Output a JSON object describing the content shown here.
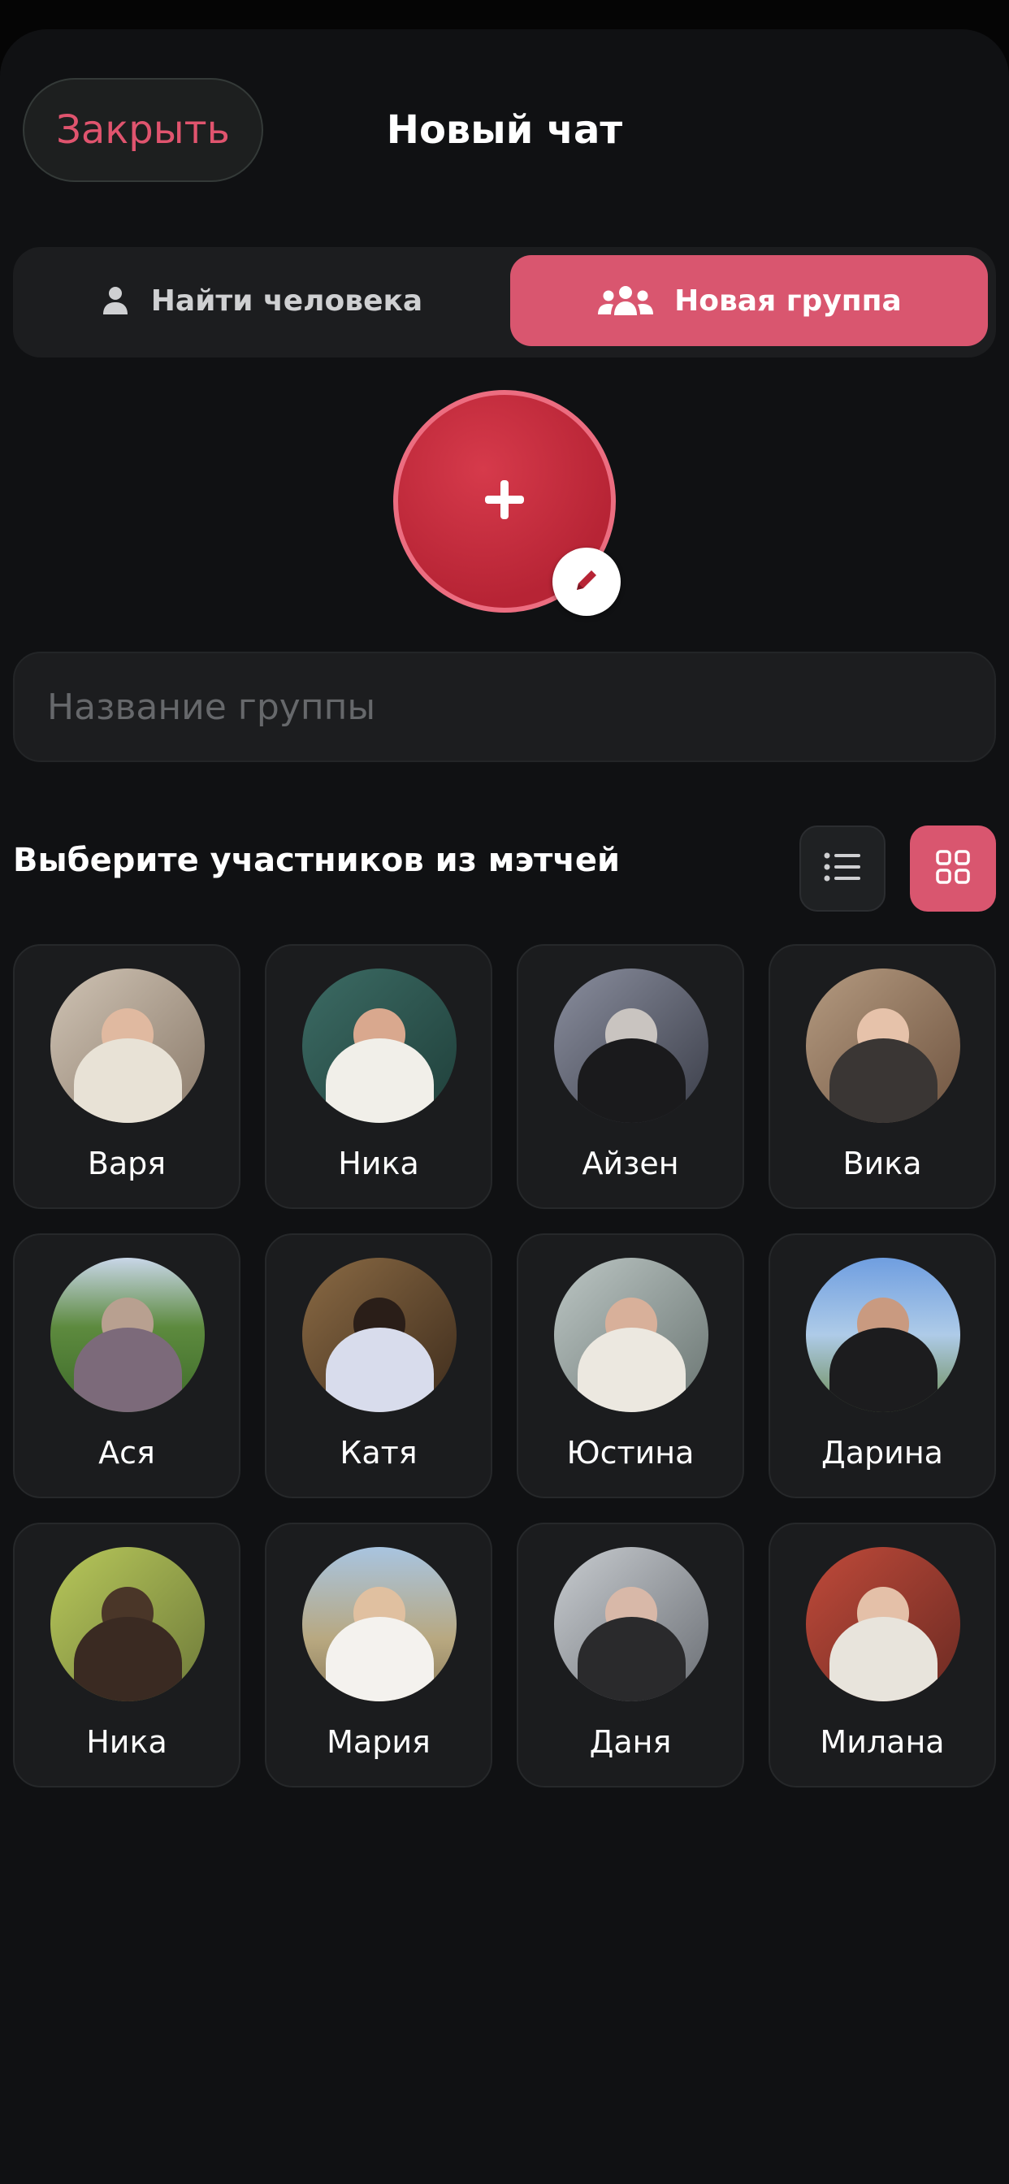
{
  "header": {
    "close_label": "Закрыть",
    "title": "Новый чат"
  },
  "tabs": {
    "find_person_label": "Найти человека",
    "new_group_label": "Новая группа",
    "active": "new_group"
  },
  "group_form": {
    "avatar_icon": "plus-icon",
    "edit_icon": "pencil-icon",
    "name_placeholder": "Название группы",
    "name_value": ""
  },
  "members_section": {
    "title": "Выберите участников из мэтчей",
    "view_modes": [
      "list",
      "grid"
    ],
    "active_view": "grid"
  },
  "matches": [
    {
      "name": "Варя"
    },
    {
      "name": "Ника"
    },
    {
      "name": "Айзен"
    },
    {
      "name": "Вика"
    },
    {
      "name": "Ася"
    },
    {
      "name": "Катя"
    },
    {
      "name": "Юстина"
    },
    {
      "name": "Дарина"
    },
    {
      "name": "Ника"
    },
    {
      "name": "Мария"
    },
    {
      "name": "Даня"
    },
    {
      "name": "Милана"
    }
  ],
  "colors": {
    "accent": "#d9566f",
    "close_text": "#e0546e",
    "background": "#101113",
    "surface": "#1c1d1f"
  }
}
